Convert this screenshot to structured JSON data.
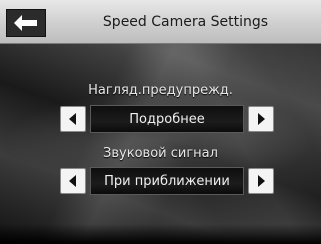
{
  "header": {
    "title": "Speed Camera Settings",
    "back_icon": "back-arrow-icon"
  },
  "settings": [
    {
      "label": "Нагляд.предупрежд.",
      "value": "Подробнее",
      "prev_icon": "left-arrow-icon",
      "next_icon": "right-arrow-icon"
    },
    {
      "label": "Звуковой сигнал",
      "value": "При приближении",
      "prev_icon": "left-arrow-icon",
      "next_icon": "right-arrow-icon"
    }
  ],
  "colors": {
    "header_bg": "#d6d6d6",
    "back_button_bg": "#2b2b2b",
    "value_bg": "#121212",
    "arrow_button_bg": "#f4f4f4"
  }
}
